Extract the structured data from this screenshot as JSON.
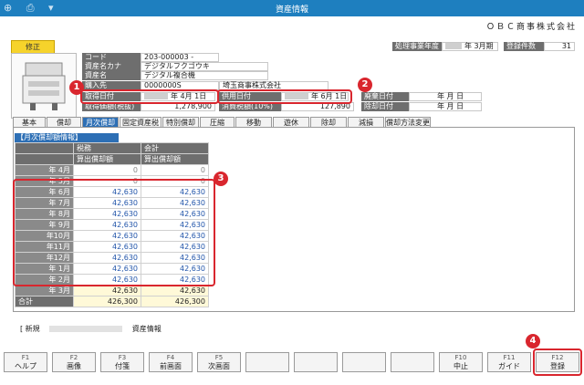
{
  "window": {
    "title": "資産情報",
    "company": "ＯＢＣ商事株式会社"
  },
  "header": {
    "edit_badge": "修正",
    "fiscal_year_label": "処理事業年度",
    "fiscal_year_value": "年 3月期",
    "count_label": "登録件数",
    "count_value": "31"
  },
  "asset": {
    "code_label": "コード",
    "code_value": "203-000003 -",
    "kana_label": "資産名カナ",
    "kana_value": "デジタルフクゴウキ",
    "name_label": "資産名",
    "name_value": "デジタル複合機",
    "supplier_label": "購入先",
    "supplier_code": "0000000S",
    "supplier_name": "埼玉商事株式会社",
    "acq_date_label": "取得日付",
    "acq_date_value": "年  4月  1日",
    "use_date_label": "供用日付",
    "use_date_value": "年  6月  1日",
    "abolish_label": "廃棄日付",
    "abolish_value": "年    月    日",
    "cost_label": "取得価額(税抜)",
    "cost_value": "1,278,900",
    "tax_label": "消費税額(10%)",
    "tax_value": "127,890",
    "remove_label": "除却日付",
    "remove_value": "年    月    日"
  },
  "tabs": [
    "基本",
    "償却",
    "月次償却",
    "固定資産税",
    "特別償却",
    "圧縮",
    "移動",
    "遊休",
    "除却",
    "減損",
    "償却方法変更"
  ],
  "table": {
    "section_title": "【月次償却額情報】",
    "col1_top": "税務",
    "col2_top": "会計",
    "col1_sub": "算出償却額",
    "col2_sub": "算出償却額",
    "rows": [
      {
        "month": "年 4月",
        "tax": "0",
        "acc": "0"
      },
      {
        "month": "年 5月",
        "tax": "0",
        "acc": "0"
      },
      {
        "month": "年 6月",
        "tax": "42,630",
        "acc": "42,630"
      },
      {
        "month": "年 7月",
        "tax": "42,630",
        "acc": "42,630"
      },
      {
        "month": "年 8月",
        "tax": "42,630",
        "acc": "42,630"
      },
      {
        "month": "年 9月",
        "tax": "42,630",
        "acc": "42,630"
      },
      {
        "month": "年10月",
        "tax": "42,630",
        "acc": "42,630"
      },
      {
        "month": "年11月",
        "tax": "42,630",
        "acc": "42,630"
      },
      {
        "month": "年12月",
        "tax": "42,630",
        "acc": "42,630"
      },
      {
        "month": "年 1月",
        "tax": "42,630",
        "acc": "42,630"
      },
      {
        "month": "年 2月",
        "tax": "42,630",
        "acc": "42,630"
      },
      {
        "month": "年 3月",
        "tax": "42,630",
        "acc": "42,630"
      }
    ],
    "total_label": "合計",
    "total_tax": "426,300",
    "total_acc": "426,300"
  },
  "status": {
    "mode": "[ 新規",
    "name": "資産情報"
  },
  "callouts": [
    "1",
    "2",
    "3",
    "4"
  ],
  "fkeys": [
    {
      "key": "F1",
      "label": "ヘルプ"
    },
    {
      "key": "F2",
      "label": "画像"
    },
    {
      "key": "F3",
      "label": "付箋"
    },
    {
      "key": "F4",
      "label": "前画面"
    },
    {
      "key": "F5",
      "label": "次画面"
    },
    {
      "key": "",
      "label": ""
    },
    {
      "key": "",
      "label": ""
    },
    {
      "key": "",
      "label": ""
    },
    {
      "key": "",
      "label": ""
    },
    {
      "key": "F10",
      "label": "中止"
    },
    {
      "key": "F11",
      "label": "ガイド"
    },
    {
      "key": "F12",
      "label": "登録"
    }
  ],
  "colors": {
    "accent": "#1e7fbf",
    "callout": "#d9262e",
    "badge": "#f6d32b"
  }
}
